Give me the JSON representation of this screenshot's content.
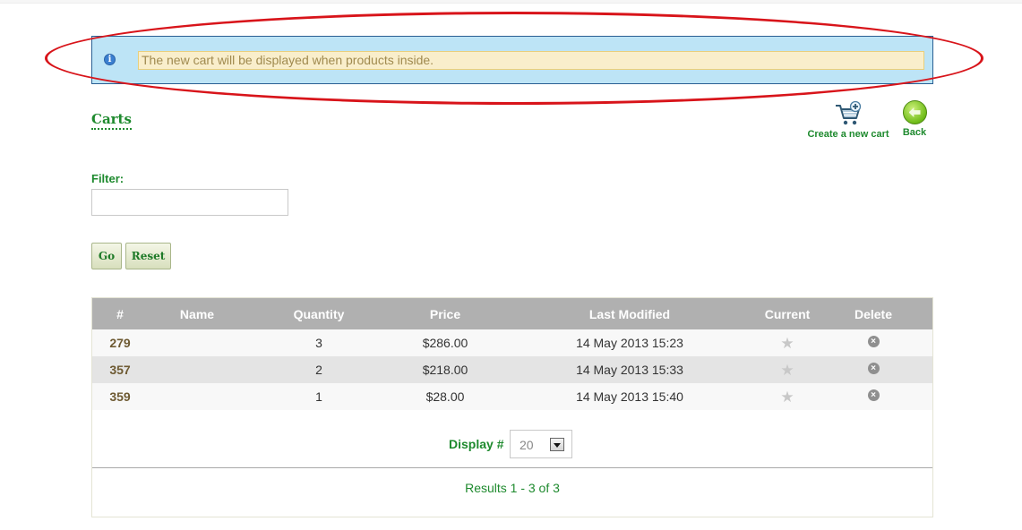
{
  "message": {
    "icon": "info-icon",
    "text": "The new cart will be displayed when products inside."
  },
  "page": {
    "title": "Carts"
  },
  "actions": {
    "create_label": "Create a new cart",
    "create_icon": "cart-add-icon",
    "back_label": "Back",
    "back_icon": "back-arrow-icon"
  },
  "filter": {
    "label": "Filter:",
    "value": "",
    "go_label": "Go",
    "reset_label": "Reset"
  },
  "table": {
    "columns": [
      "#",
      "Name",
      "Quantity",
      "Price",
      "Last Modified",
      "Current",
      "Delete"
    ],
    "rows": [
      {
        "id": "279",
        "name": "",
        "quantity": "3",
        "price": "$286.00",
        "modified": "14 May 2013 15:23",
        "current_icon": "star-icon",
        "delete_icon": "delete-icon"
      },
      {
        "id": "357",
        "name": "",
        "quantity": "2",
        "price": "$218.00",
        "modified": "14 May 2013 15:33",
        "current_icon": "star-icon",
        "delete_icon": "delete-icon"
      },
      {
        "id": "359",
        "name": "",
        "quantity": "1",
        "price": "$28.00",
        "modified": "14 May 2013 15:40",
        "current_icon": "star-icon",
        "delete_icon": "delete-icon"
      }
    ]
  },
  "pagination": {
    "display_label": "Display #",
    "display_value": "20",
    "results_text": "Results 1 - 3 of 3"
  },
  "colors": {
    "accent_green": "#1e8a2e",
    "info_background": "#bde4f6",
    "highlight_red": "#d8141a"
  }
}
